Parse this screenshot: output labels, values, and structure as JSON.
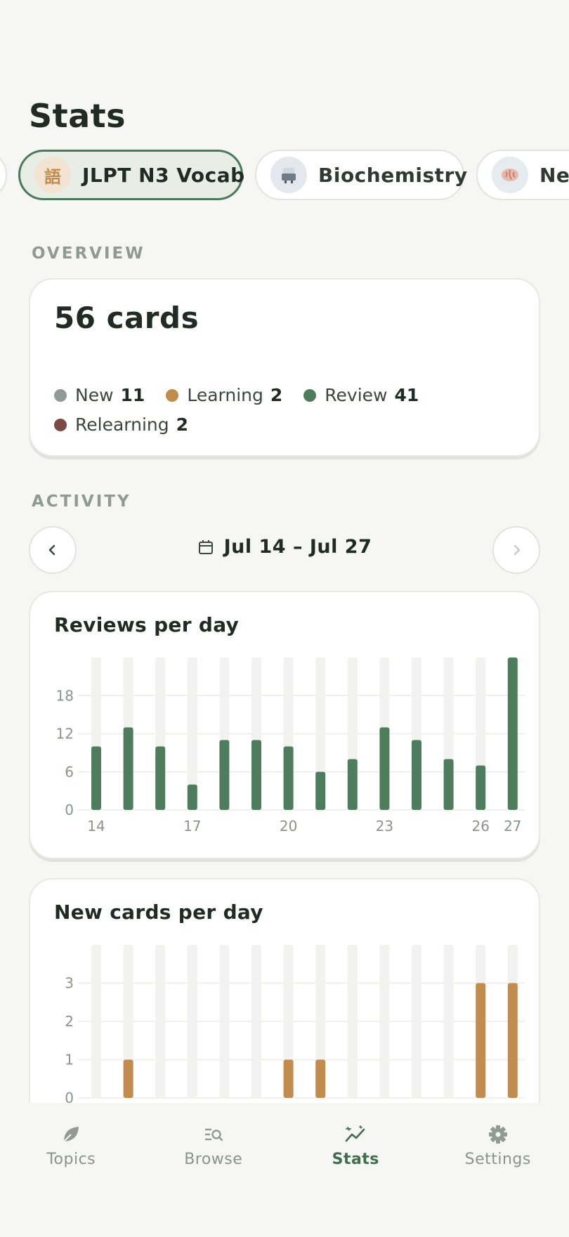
{
  "page": {
    "title": "Stats"
  },
  "topics": [
    {
      "label": "",
      "icon": ""
    },
    {
      "label": "JLPT N3 Vocab",
      "icon": "語",
      "icon_name": "kanji-icon",
      "active": true
    },
    {
      "label": "Biochemistry",
      "icon": "⚗",
      "icon_name": "lab-icon",
      "active": false
    },
    {
      "label": "Neu",
      "icon": "🧠",
      "icon_name": "brain-icon",
      "active": false
    }
  ],
  "overview": {
    "section_label": "OVERVIEW",
    "count_text": "56 cards",
    "legend": [
      {
        "label": "New",
        "value": "11",
        "color": "#8f9b94"
      },
      {
        "label": "Learning",
        "value": "2",
        "color": "#c18c4d"
      },
      {
        "label": "Review",
        "value": "41",
        "color": "#4d7d5c"
      },
      {
        "label": "Relearning",
        "value": "2",
        "color": "#7b4a44"
      }
    ]
  },
  "activity": {
    "section_label": "ACTIVITY",
    "date_range": "Jul 14 – Jul 27"
  },
  "chart_data": [
    {
      "type": "bar",
      "title": "Reviews per day",
      "color": "#4d7d5c",
      "categories": [
        "14",
        "15",
        "16",
        "17",
        "18",
        "19",
        "20",
        "21",
        "22",
        "23",
        "24",
        "25",
        "26",
        "27"
      ],
      "x_tick_labels": [
        "14",
        "17",
        "20",
        "23",
        "26",
        "27"
      ],
      "values": [
        10,
        13,
        10,
        4,
        11,
        11,
        10,
        6,
        8,
        13,
        11,
        8,
        7,
        24
      ],
      "y_ticks": [
        "0",
        "6",
        "12",
        "18"
      ],
      "ylim": [
        0,
        24
      ]
    },
    {
      "type": "bar",
      "title": "New cards per day",
      "color": "#c18c4d",
      "categories": [
        "14",
        "15",
        "16",
        "17",
        "18",
        "19",
        "20",
        "21",
        "22",
        "23",
        "24",
        "25",
        "26",
        "27"
      ],
      "values": [
        0,
        1,
        0,
        0,
        0,
        0,
        1,
        1,
        0,
        0,
        0,
        0,
        3,
        3
      ],
      "y_ticks": [
        "0",
        "1",
        "2",
        "3"
      ],
      "ylim": [
        0,
        4
      ]
    }
  ],
  "bottom_nav": [
    {
      "label": "Topics",
      "icon": "leaf-icon"
    },
    {
      "label": "Browse",
      "icon": "browse-search-icon"
    },
    {
      "label": "Stats",
      "icon": "stats-icon",
      "active": true
    },
    {
      "label": "Settings",
      "icon": "gear-icon"
    }
  ]
}
